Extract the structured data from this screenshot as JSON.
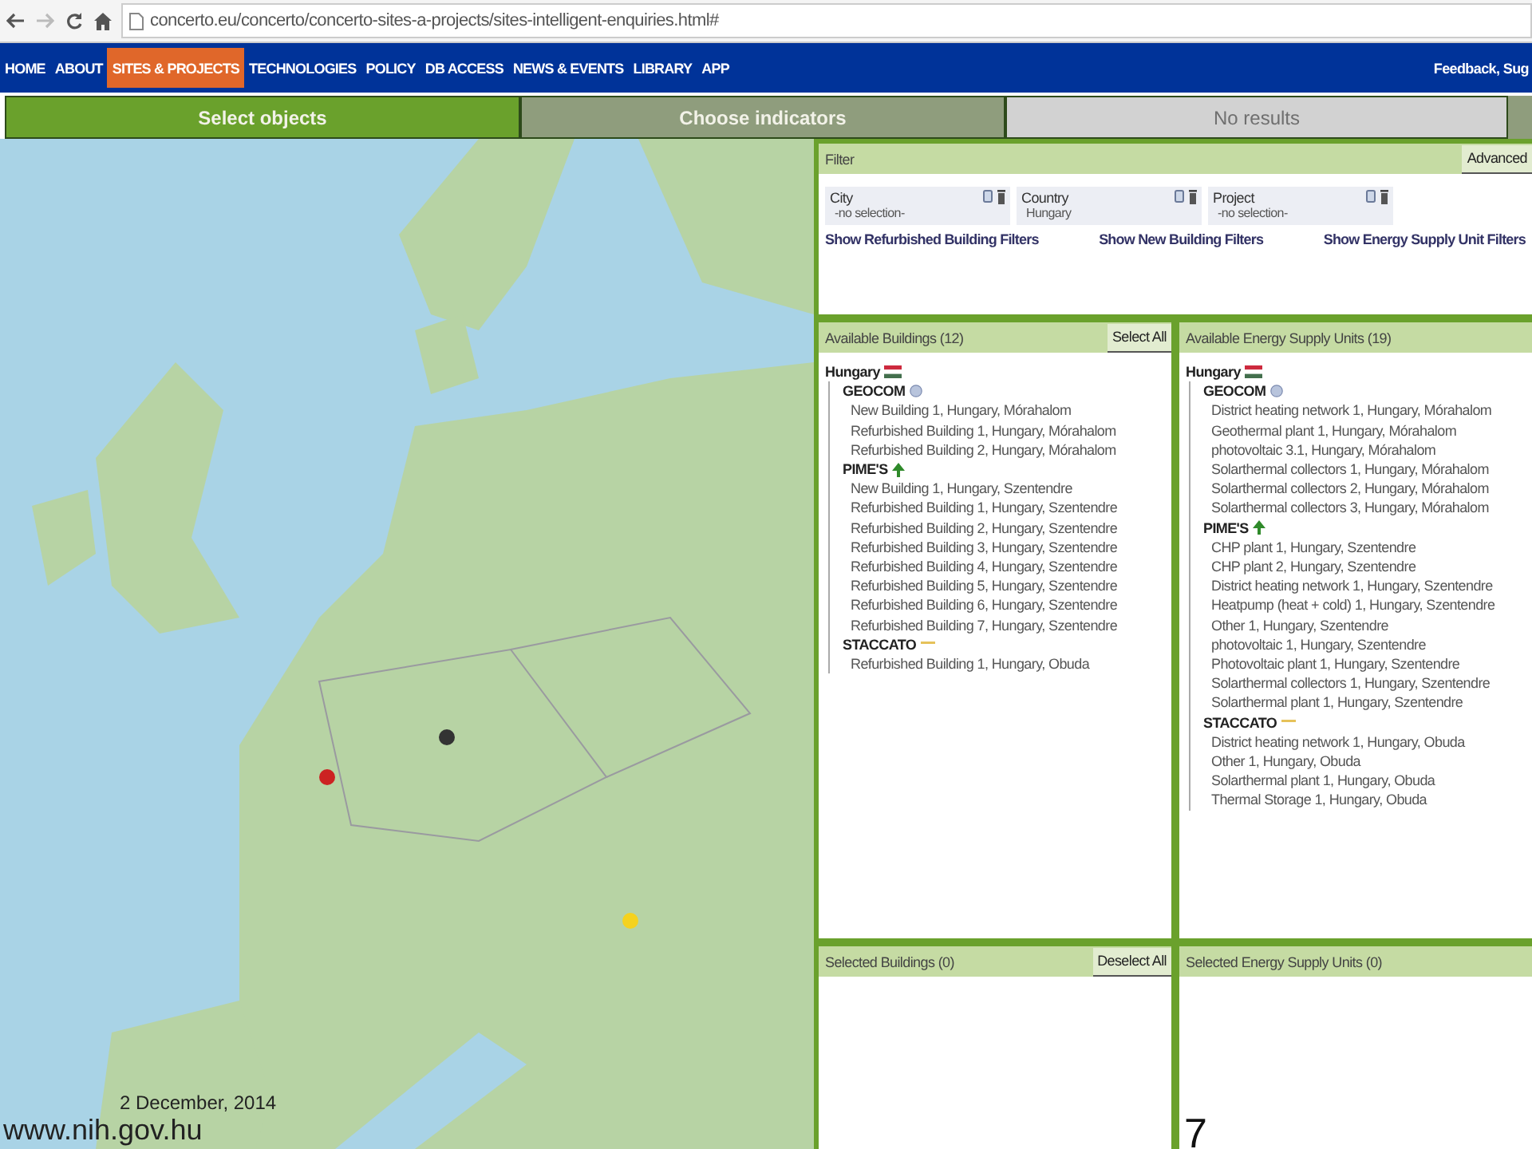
{
  "browser": {
    "url": "concerto.eu/concerto/concerto-sites-a-projects/sites-intelligent-enquiries.html#"
  },
  "nav": {
    "items": [
      {
        "label": "HOME",
        "selected": false
      },
      {
        "label": "ABOUT",
        "selected": false
      },
      {
        "label": "SITES & PROJECTS",
        "selected": true
      },
      {
        "label": "TECHNOLOGIES",
        "selected": false
      },
      {
        "label": "POLICY",
        "selected": false
      },
      {
        "label": "DB ACCESS",
        "selected": false
      },
      {
        "label": "NEWS & EVENTS",
        "selected": false
      },
      {
        "label": "LIBRARY",
        "selected": false
      },
      {
        "label": "APP",
        "selected": false
      }
    ],
    "right_link": "Feedback, Sug"
  },
  "steps": [
    {
      "label": "Select objects",
      "selected": true,
      "disabled": false
    },
    {
      "label": "Choose indicators",
      "selected": false,
      "disabled": false
    },
    {
      "label": "No results",
      "selected": false,
      "disabled": true
    }
  ],
  "filter": {
    "title": "Filter",
    "advanced_button": "Advanced",
    "fields": [
      {
        "label": "City",
        "value": "-no selection-"
      },
      {
        "label": "Country",
        "value": "Hungary"
      },
      {
        "label": "Project",
        "value": "-no selection-"
      }
    ],
    "links": [
      "Show Refurbished Building Filters",
      "Show New Building Filters",
      "Show Energy Supply Unit Filters"
    ]
  },
  "available": [
    {
      "title": "Available Buildings (12)",
      "button": "Select All",
      "tree": [
        {
          "label": "Hungary",
          "kind": "country",
          "children": [
            {
              "label": "GEOCOM",
              "kind": "globe",
              "children": [
                {
                  "label": "New Building 1, Hungary, Mórahalom"
                },
                {
                  "label": "Refurbished Building 1, Hungary, Mórahalom"
                },
                {
                  "label": "Refurbished Building 2, Hungary, Mórahalom"
                }
              ]
            },
            {
              "label": "PIME'S",
              "kind": "tree",
              "children": [
                {
                  "label": "New Building 1, Hungary, Szentendre"
                },
                {
                  "label": "Refurbished Building 1, Hungary, Szentendre"
                },
                {
                  "label": "Refurbished Building 2, Hungary, Szentendre"
                },
                {
                  "label": "Refurbished Building 3, Hungary, Szentendre"
                },
                {
                  "label": "Refurbished Building 4, Hungary, Szentendre"
                },
                {
                  "label": "Refurbished Building 5, Hungary, Szentendre"
                },
                {
                  "label": "Refurbished Building 6, Hungary, Szentendre"
                },
                {
                  "label": "Refurbished Building 7, Hungary, Szentendre"
                }
              ]
            },
            {
              "label": "STACCATO",
              "kind": "dash",
              "children": [
                {
                  "label": "Refurbished Building 1, Hungary, Obuda"
                }
              ]
            }
          ]
        }
      ]
    },
    {
      "title": "Available Energy Supply Units (19)",
      "tree": [
        {
          "label": "Hungary",
          "kind": "country",
          "children": [
            {
              "label": "GEOCOM",
              "kind": "globe",
              "children": [
                {
                  "label": "District heating network 1, Hungary, Mórahalom"
                },
                {
                  "label": "Geothermal plant 1, Hungary, Mórahalom"
                },
                {
                  "label": "photovoltaic 3.1, Hungary, Mórahalom"
                },
                {
                  "label": "Solarthermal collectors 1, Hungary, Mórahalom"
                },
                {
                  "label": "Solarthermal collectors 2, Hungary, Mórahalom"
                },
                {
                  "label": "Solarthermal collectors 3, Hungary, Mórahalom"
                }
              ]
            },
            {
              "label": "PIME'S",
              "kind": "tree",
              "children": [
                {
                  "label": "CHP plant 1, Hungary, Szentendre"
                },
                {
                  "label": "CHP plant 2, Hungary, Szentendre"
                },
                {
                  "label": "District heating network 1, Hungary, Szentendre"
                },
                {
                  "label": "Heatpump (heat + cold) 1, Hungary, Szentendre"
                },
                {
                  "label": "Other 1, Hungary, Szentendre"
                },
                {
                  "label": "photovoltaic 1, Hungary, Szentendre"
                },
                {
                  "label": "Photovoltaic plant 1, Hungary, Szentendre"
                },
                {
                  "label": "Solarthermal collectors 1, Hungary, Szentendre"
                },
                {
                  "label": "Solarthermal plant 1, Hungary, Szentendre"
                }
              ]
            },
            {
              "label": "STACCATO",
              "kind": "dash",
              "children": [
                {
                  "label": "District heating network 1, Hungary, Obuda"
                },
                {
                  "label": "Other 1, Hungary, Obuda"
                },
                {
                  "label": "Solarthermal plant 1, Hungary, Obuda"
                },
                {
                  "label": "Thermal Storage 1, Hungary, Obuda"
                }
              ]
            }
          ]
        }
      ]
    }
  ],
  "selected": [
    {
      "title": "Selected Buildings (0)",
      "button": "Deselect All"
    },
    {
      "title": "Selected Energy Supply Units (0)"
    }
  ],
  "slide": {
    "date": "2 December, 2014",
    "url": "www.nih.gov.hu",
    "page_number": "7"
  }
}
